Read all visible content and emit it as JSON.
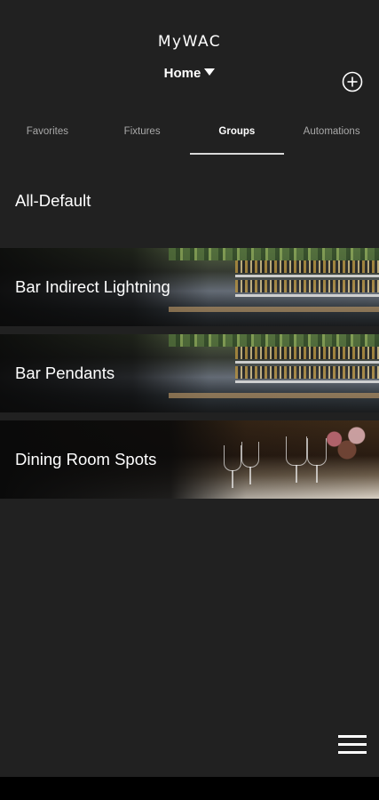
{
  "app": {
    "title": "MyWAC"
  },
  "header": {
    "location": "Home",
    "add_icon": "plus-circle-icon"
  },
  "tabs": [
    {
      "label": "Favorites",
      "active": false
    },
    {
      "label": "Fixtures",
      "active": false
    },
    {
      "label": "Groups",
      "active": true
    },
    {
      "label": "Automations",
      "active": false
    }
  ],
  "groups": [
    {
      "label": "All-Default",
      "background": "none"
    },
    {
      "label": "Bar Indirect Lightning",
      "background": "bar-photo"
    },
    {
      "label": "Bar Pendants",
      "background": "bar-photo"
    },
    {
      "label": "Dining Room Spots",
      "background": "dining-photo"
    }
  ],
  "footer": {
    "menu_icon": "hamburger-menu-icon"
  },
  "colors": {
    "background": "#212121",
    "text": "#ffffff",
    "inactive_tab": "#a9a9a9",
    "bottom_bar": "#000000"
  }
}
